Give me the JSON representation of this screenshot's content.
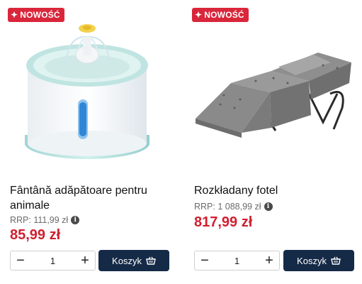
{
  "products": [
    {
      "badge": "NOWOŚĆ",
      "badge_icon": "sparkle-icon",
      "image": "water-fountain-image",
      "title": "Fântână adăpătoare pentru animale",
      "rrp": "RRP: 111,99 zł",
      "price": "85,99 zł",
      "quantity": "1",
      "minus": "−",
      "plus": "+",
      "cart_label": "Koszyk",
      "cart_icon": "basket-icon"
    },
    {
      "badge": "NOWOŚĆ",
      "badge_icon": "sparkle-icon",
      "image": "folding-armchair-image",
      "title": "Rozkładany fotel",
      "rrp": "RRP: 1 088,99 zł",
      "price": "817,99 zł",
      "quantity": "1",
      "minus": "−",
      "plus": "+",
      "cart_label": "Koszyk",
      "cart_icon": "basket-icon"
    }
  ],
  "colors": {
    "badge": "#d9263a",
    "price": "#d11f2f",
    "cart_button": "#152a47"
  }
}
